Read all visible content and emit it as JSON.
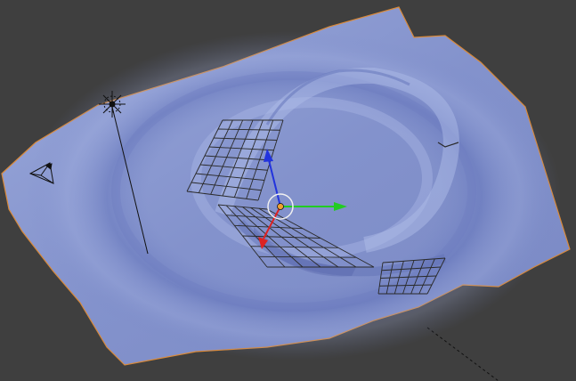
{
  "viewport": {
    "background_color": "#3f3f3f",
    "mesh_color": "#8c9bd0",
    "mesh_edge_color": "#d98a3a",
    "axis_colors": {
      "x": "#22cc22",
      "y": "#2233dd",
      "z": "#dd2222"
    },
    "selection_color": "#f0f0f0",
    "object_origin_color": "#f0a030"
  },
  "scene_objects": [
    {
      "name": "lamp",
      "icon": "lamp-icon"
    },
    {
      "name": "camera",
      "icon": "camera-icon"
    },
    {
      "name": "wave-mesh",
      "icon": "mesh-icon"
    },
    {
      "name": "transform-manipulator",
      "icon": "manipulator-icon"
    }
  ]
}
